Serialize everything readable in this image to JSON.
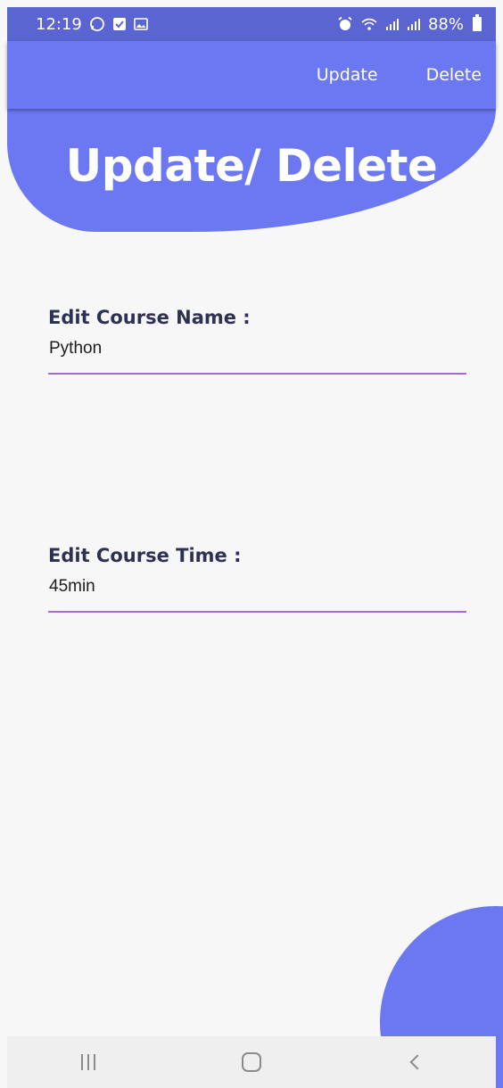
{
  "status_bar": {
    "time": "12:19",
    "battery": "88%",
    "left_icons": [
      "whatsapp-icon",
      "check-box-icon",
      "image-icon"
    ],
    "right_icons": [
      "alarm-icon",
      "wifi-icon",
      "signal-icon",
      "signal-icon"
    ]
  },
  "app_bar": {
    "actions": {
      "update": "Update",
      "delete": "Delete"
    }
  },
  "header": {
    "title": "Update/ Delete"
  },
  "form": {
    "course_name": {
      "label": "Edit Course Name :",
      "value": "Python"
    },
    "course_time": {
      "label": "Edit Course Time :",
      "value": "45min"
    }
  },
  "colors": {
    "status_bar": "#5a65d2",
    "primary": "#6b78f2",
    "label": "#2f3153",
    "underline": "#a56bd0",
    "background": "#f7f7f8"
  },
  "nav_bar": {
    "icons": [
      "recents-icon",
      "home-icon",
      "back-icon"
    ]
  }
}
